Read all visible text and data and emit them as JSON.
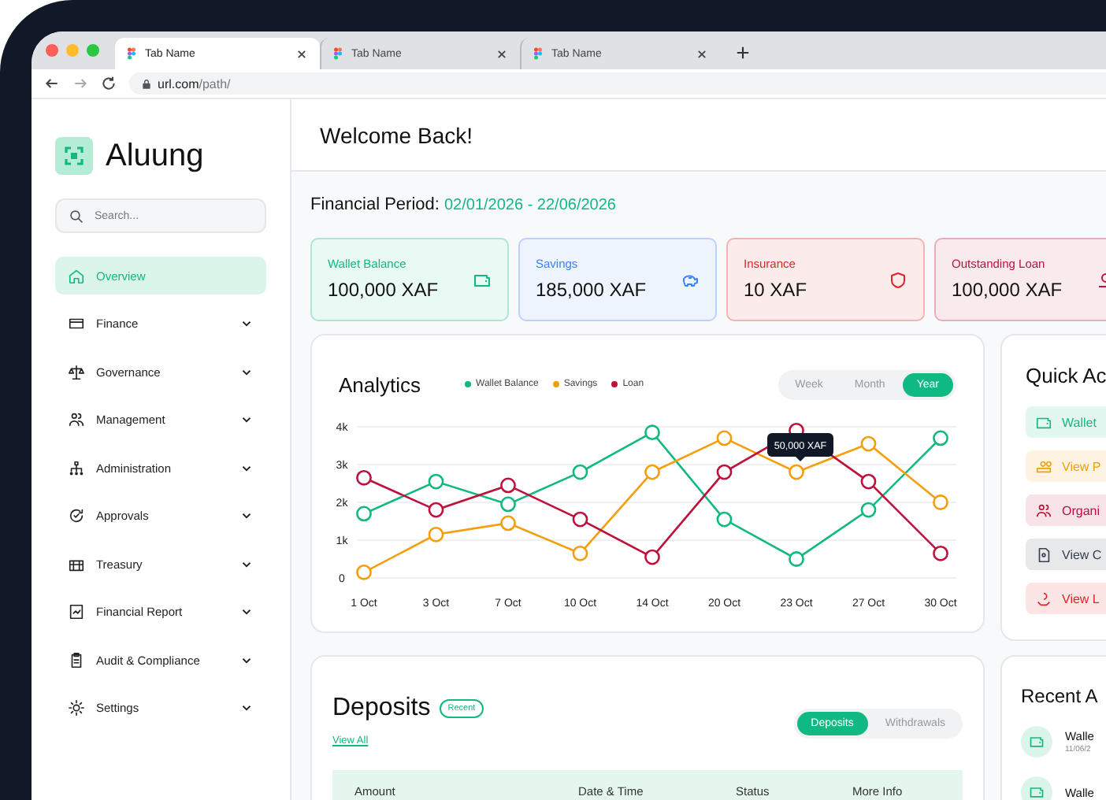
{
  "browser": {
    "tabs": [
      {
        "label": "Tab Name",
        "selected": true
      },
      {
        "label": "Tab Name",
        "selected": false
      },
      {
        "label": "Tab Name",
        "selected": false
      }
    ],
    "url_host": "url.com",
    "url_path": "/path/"
  },
  "sidebar": {
    "brand": "Aluung",
    "search": {
      "placeholder": "Search..."
    },
    "items": [
      {
        "label": "Overview",
        "kind": "link",
        "selected": true
      },
      {
        "label": "Finance",
        "kind": "group",
        "selected": false
      },
      {
        "label": "Governance",
        "kind": "group",
        "selected": false
      },
      {
        "label": "Management",
        "kind": "group",
        "selected": false
      },
      {
        "label": "Administration",
        "kind": "group",
        "selected": false
      },
      {
        "label": "Approvals",
        "kind": "group",
        "selected": false
      },
      {
        "label": "Treasury",
        "kind": "group",
        "selected": false
      },
      {
        "label": "Financial Report",
        "kind": "group",
        "selected": false
      },
      {
        "label": "Audit & Compliance",
        "kind": "group",
        "selected": false
      },
      {
        "label": "Settings",
        "kind": "group",
        "selected": false
      }
    ]
  },
  "header": {
    "title": "Welcome Back!"
  },
  "financial_period": {
    "label": "Financial Period:",
    "range": "02/01/2026 - 22/06/2026"
  },
  "stats": [
    {
      "label": "Wallet Balance",
      "value": "100,000 XAF",
      "color": "#10b981"
    },
    {
      "label": "Savings",
      "value": "185,000 XAF",
      "color": "#3b82f6"
    },
    {
      "label": "Insurance",
      "value": "10 XAF",
      "color": "#dc2626"
    },
    {
      "label": "Outstanding Loan",
      "value": "100,000 XAF",
      "color": "#be123c"
    }
  ],
  "analytics": {
    "title": "Analytics",
    "ranges": [
      {
        "label": "Week",
        "selected": false
      },
      {
        "label": "Month",
        "selected": false
      },
      {
        "label": "Year",
        "selected": true
      }
    ],
    "tooltip": "50,000 XAF",
    "chart_data": {
      "type": "line",
      "grid": true,
      "categories": [
        "1 Oct",
        "3 Oct",
        "7 Oct",
        "10 Oct",
        "14 Oct",
        "20 Oct",
        "23 Oct",
        "27 Oct",
        "30 Oct"
      ],
      "ylim": [
        0,
        4000
      ],
      "yticks": [
        {
          "value": 0,
          "label": "0"
        },
        {
          "value": 1000,
          "label": "1k"
        },
        {
          "value": 2000,
          "label": "2k"
        },
        {
          "value": 3000,
          "label": "3k"
        },
        {
          "value": 4000,
          "label": "4k"
        }
      ],
      "series": [
        {
          "name": "Wallet Balance",
          "color": "#10b981",
          "marker": "circle",
          "values": [
            1700,
            2550,
            1950,
            2800,
            3850,
            1550,
            500,
            1800,
            3700
          ]
        },
        {
          "name": "Savings",
          "color": "#f59e0b",
          "marker": "circle",
          "values": [
            150,
            1150,
            1450,
            650,
            2800,
            3700,
            2800,
            3550,
            2000
          ]
        },
        {
          "name": "Loan",
          "color": "#be123c",
          "marker": "circle",
          "values": [
            2650,
            1800,
            2450,
            1550,
            550,
            2800,
            3900,
            2550,
            650
          ]
        }
      ]
    }
  },
  "quick_actions": {
    "title": "Quick Ac",
    "items": [
      {
        "label": "Wallet",
        "color": "#10b981"
      },
      {
        "label": "View P",
        "color": "#f59e0b"
      },
      {
        "label": "Organi",
        "color": "#be123c"
      },
      {
        "label": "View C",
        "color": "#374151"
      },
      {
        "label": "View L",
        "color": "#dc2626"
      }
    ]
  },
  "deposits": {
    "title": "Deposits",
    "badge": "Recent",
    "link": "View All",
    "tabs": [
      {
        "label": "Deposits",
        "selected": true
      },
      {
        "label": "Withdrawals",
        "selected": false
      }
    ],
    "columns": [
      "Amount",
      "Date & Time",
      "Status",
      "More Info"
    ]
  },
  "recent": {
    "title": "Recent A",
    "items": [
      {
        "title": "Walle",
        "date": "11/06/2"
      },
      {
        "title": "Walle"
      }
    ]
  }
}
